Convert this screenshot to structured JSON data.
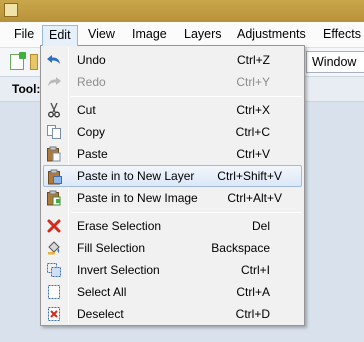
{
  "menubar": {
    "items": [
      {
        "label": "File"
      },
      {
        "label": "Edit"
      },
      {
        "label": "View"
      },
      {
        "label": "Image"
      },
      {
        "label": "Layers"
      },
      {
        "label": "Adjustments"
      },
      {
        "label": "Effects"
      }
    ]
  },
  "toolbar": {
    "window_label": "Window",
    "tools_label": "Tool:"
  },
  "edit_menu": {
    "items": [
      {
        "label": "Undo",
        "shortcut": "Ctrl+Z",
        "icon": "undo-icon"
      },
      {
        "label": "Redo",
        "shortcut": "Ctrl+Y",
        "icon": "redo-icon"
      },
      {
        "label": "Cut",
        "shortcut": "Ctrl+X",
        "icon": "cut-icon"
      },
      {
        "label": "Copy",
        "shortcut": "Ctrl+C",
        "icon": "copy-icon"
      },
      {
        "label": "Paste",
        "shortcut": "Ctrl+V",
        "icon": "paste-icon"
      },
      {
        "label": "Paste in to New Layer",
        "shortcut": "Ctrl+Shift+V",
        "icon": "paste-new-layer-icon"
      },
      {
        "label": "Paste in to New Image",
        "shortcut": "Ctrl+Alt+V",
        "icon": "paste-new-image-icon"
      },
      {
        "label": "Erase Selection",
        "shortcut": "Del",
        "icon": "erase-selection-icon"
      },
      {
        "label": "Fill Selection",
        "shortcut": "Backspace",
        "icon": "fill-selection-icon"
      },
      {
        "label": "Invert Selection",
        "shortcut": "Ctrl+I",
        "icon": "invert-selection-icon"
      },
      {
        "label": "Select All",
        "shortcut": "Ctrl+A",
        "icon": "select-all-icon"
      },
      {
        "label": "Deselect",
        "shortcut": "Ctrl+D",
        "icon": "deselect-icon"
      }
    ]
  },
  "colors": {
    "accent": "#9fbbe0",
    "hover_top": "#f2f6fb",
    "hover_bottom": "#dbe8f7"
  }
}
